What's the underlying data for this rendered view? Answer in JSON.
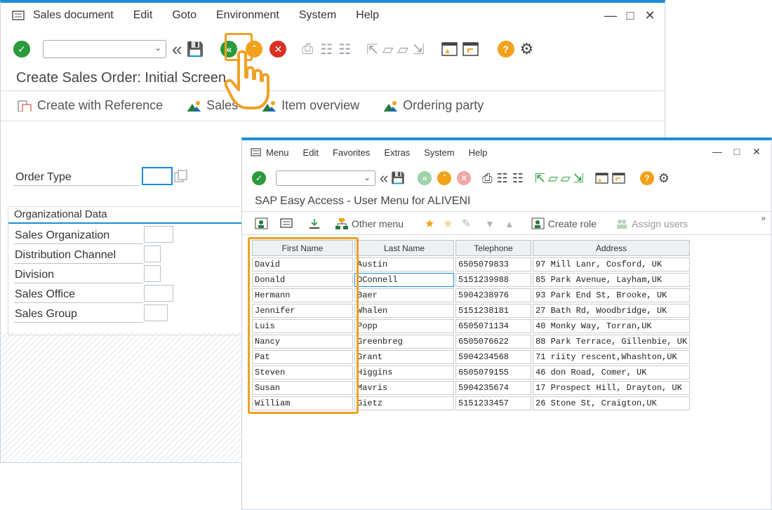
{
  "back_window": {
    "menu": [
      "Sales document",
      "Edit",
      "Goto",
      "Environment",
      "System",
      "Help"
    ],
    "title": "Create Sales Order: Initial Screen",
    "app_buttons": [
      "Create with Reference",
      "Sales",
      "Item overview",
      "Ordering party"
    ],
    "order_type_label": "Order Type",
    "org_header": "Organizational Data",
    "org_fields": [
      "Sales Organization",
      "Distribution Channel",
      "Division",
      "Sales Office",
      "Sales Group"
    ]
  },
  "front_window": {
    "menu": [
      "Menu",
      "Edit",
      "Favorites",
      "Extras",
      "System",
      "Help"
    ],
    "title": "SAP Easy Access  -  User Menu for ALIVENI",
    "app_buttons": {
      "other_menu": "Other menu",
      "create_role": "Create role",
      "assign_users": "Assign users"
    },
    "table": {
      "headers": [
        "First Name",
        "Last Name",
        "Telephone",
        "Address"
      ],
      "rows": [
        [
          "David",
          "Austin",
          "6505079833",
          "97 Mill Lanr, Cosford, UK"
        ],
        [
          "Donald",
          "OConnell",
          "5151239988",
          "85 Park Avenue, Layham,UK"
        ],
        [
          "Hermann",
          "Baer",
          "5904238976",
          "93 Park End St, Brooke, UK"
        ],
        [
          "Jennifer",
          "Whalen",
          "5151238181",
          "27 Bath Rd, Woodbridge, UK"
        ],
        [
          "Luis",
          "Popp",
          "6505071134",
          "40 Monky Way, Torran,UK"
        ],
        [
          "Nancy",
          "Greenbreg",
          "6505076622",
          "88 Park Terrace, Gillenbie, UK"
        ],
        [
          "Pat",
          "Grant",
          "5904234568",
          "71 riity rescent,Whashton,UK"
        ],
        [
          "Steven",
          "Higgins",
          "6505079155",
          "46 don Road, Comer, UK"
        ],
        [
          "Susan",
          "Mavris",
          "5904235674",
          "17 Prospect Hill, Drayton, UK"
        ],
        [
          "William",
          "Gietz",
          "5151233457",
          "26 Stone St, Craigton,UK"
        ]
      ]
    }
  },
  "colors": {
    "accent": "#1a8dd8",
    "highlight": "#f0a025",
    "green": "#2a9a3a",
    "orange": "#f2a21a",
    "red": "#d93025"
  }
}
